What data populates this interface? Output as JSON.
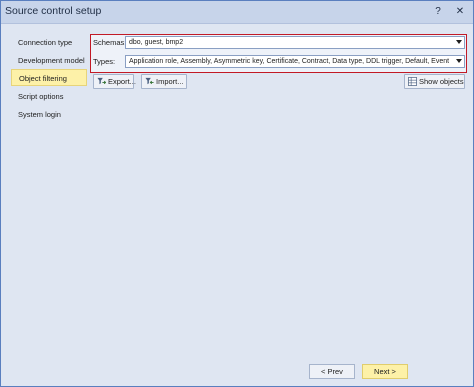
{
  "window": {
    "title": "Source control setup",
    "help_label": "?",
    "close_label": "✕"
  },
  "sidebar": {
    "items": [
      {
        "label": "Connection type",
        "active": false
      },
      {
        "label": "Development model",
        "active": false
      },
      {
        "label": "Object filtering",
        "active": true
      },
      {
        "label": "Script options",
        "active": false
      },
      {
        "label": "System login",
        "active": false
      }
    ]
  },
  "filters": {
    "schemas_label": "Schemas:",
    "schemas_value": "dbo, guest, bmp2",
    "types_label": "Types:",
    "types_value": "Application role, Assembly, Asymmetric key, Certificate, Contract, Data type, DDL trigger, Default, Event notifi..."
  },
  "toolbar": {
    "export_label": "Export...",
    "import_label": "Import...",
    "show_objects_label": "Show objects"
  },
  "footer": {
    "prev_label": "< Prev",
    "next_label": "Next >"
  },
  "colors": {
    "highlight_border": "#c21a26",
    "active_nav_bg": "#fdf1a8",
    "window_bg": "#dfe6f2"
  }
}
